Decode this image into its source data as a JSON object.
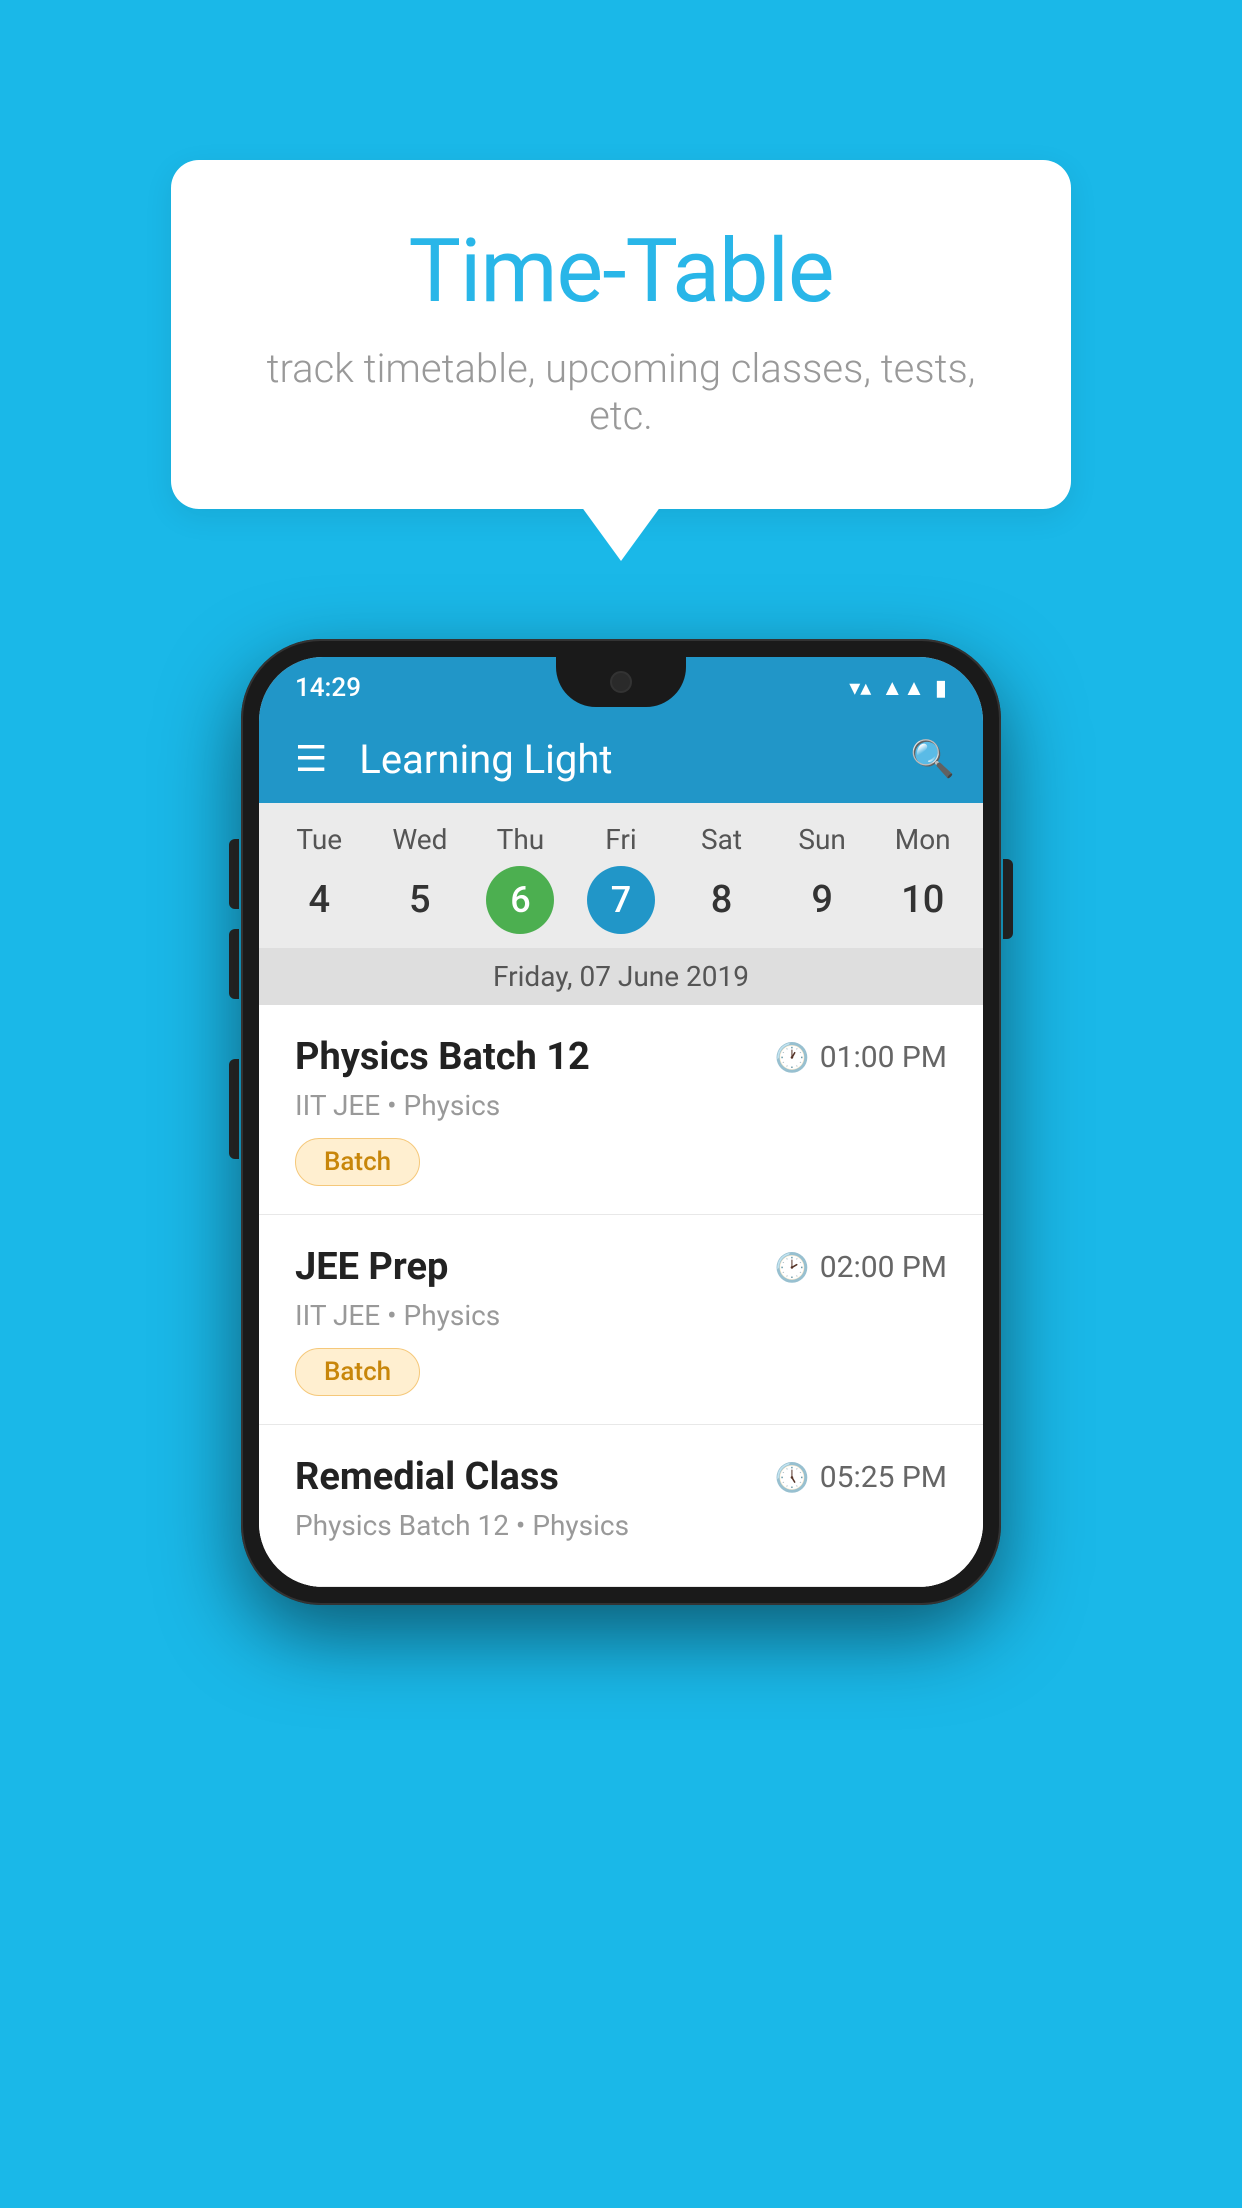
{
  "background_color": "#1ab8e8",
  "tooltip": {
    "title": "Time-Table",
    "subtitle": "track timetable, upcoming classes, tests, etc."
  },
  "app": {
    "status_time": "14:29",
    "title": "Learning Light",
    "menu_icon": "☰",
    "search_icon": "🔍"
  },
  "calendar": {
    "days": [
      {
        "name": "Tue",
        "num": "4",
        "style": "normal"
      },
      {
        "name": "Wed",
        "num": "5",
        "style": "normal"
      },
      {
        "name": "Thu",
        "num": "6",
        "style": "green"
      },
      {
        "name": "Fri",
        "num": "7",
        "style": "blue"
      },
      {
        "name": "Sat",
        "num": "8",
        "style": "normal"
      },
      {
        "name": "Sun",
        "num": "9",
        "style": "normal"
      },
      {
        "name": "Mon",
        "num": "10",
        "style": "normal"
      }
    ],
    "selected_date": "Friday, 07 June 2019"
  },
  "schedule": [
    {
      "name": "Physics Batch 12",
      "time": "01:00 PM",
      "sub": "IIT JEE • Physics",
      "badge": "Batch"
    },
    {
      "name": "JEE Prep",
      "time": "02:00 PM",
      "sub": "IIT JEE • Physics",
      "badge": "Batch"
    },
    {
      "name": "Remedial Class",
      "time": "05:25 PM",
      "sub": "Physics Batch 12 • Physics",
      "badge": ""
    }
  ]
}
